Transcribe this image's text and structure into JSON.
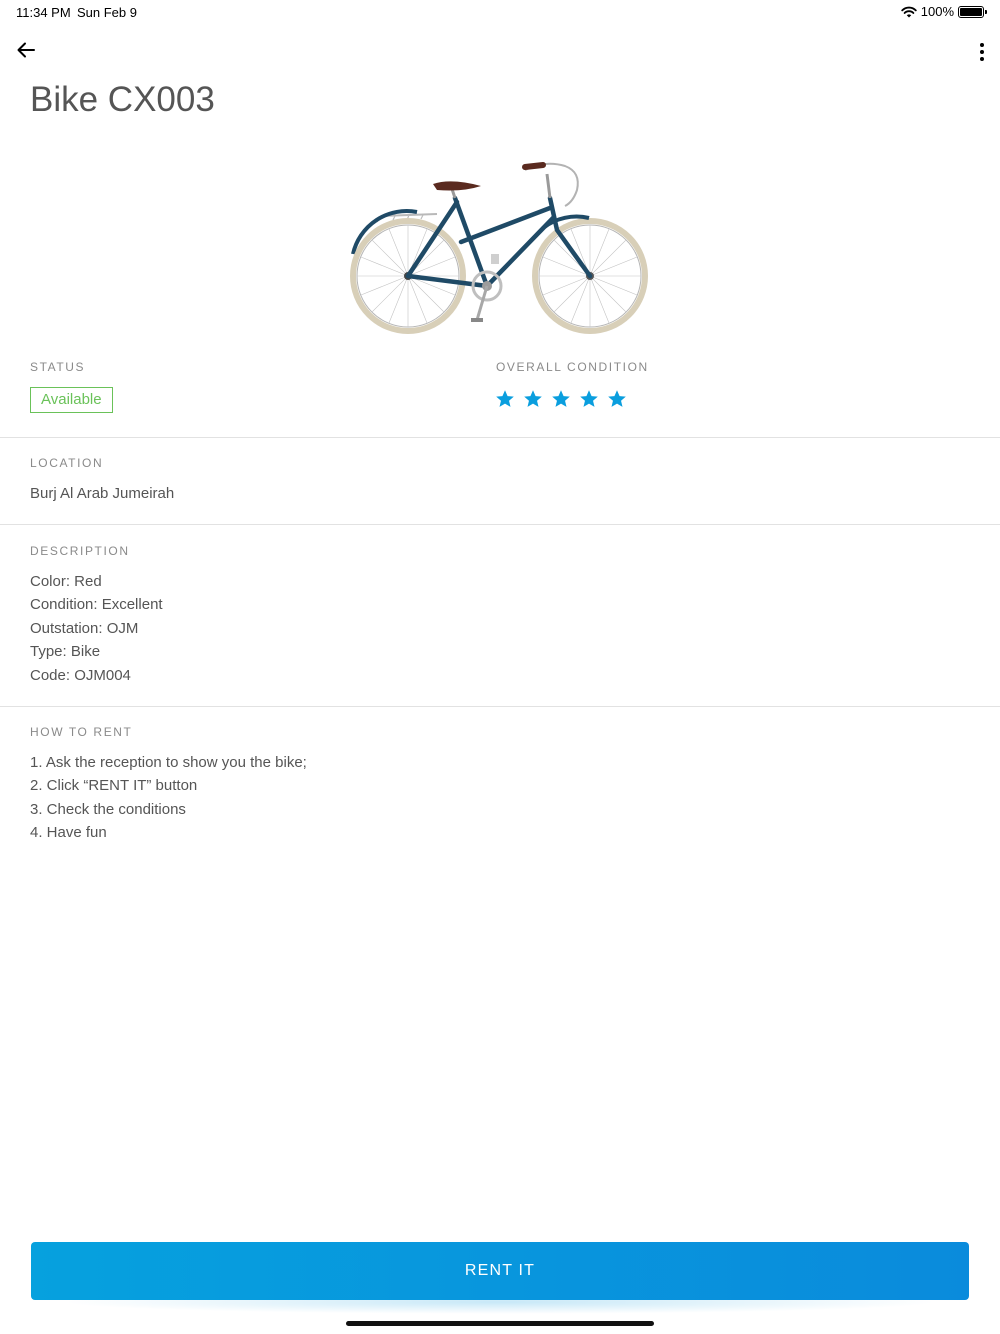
{
  "status_bar": {
    "time": "11:34 PM",
    "date": "Sun Feb 9",
    "battery": "100%"
  },
  "nav": {
    "back_icon": "arrow-left-icon",
    "more_icon": "more-vertical-icon"
  },
  "title": "Bike CX003",
  "bike_image": {
    "icon": "bicycle-illustration",
    "frame_color": "#1f4a66"
  },
  "status": {
    "label": "STATUS",
    "value": "Available",
    "color": "#6ac259"
  },
  "condition": {
    "label": "OVERALL CONDITION",
    "rating": 5,
    "max": 5,
    "star_color": "#0a9ede"
  },
  "location": {
    "label": "LOCATION",
    "value": "Burj Al Arab Jumeirah"
  },
  "description": {
    "label": "DESCRIPTION",
    "lines": [
      "Color: Red",
      "Condition: Excellent",
      "Outstation: OJM",
      "Type: Bike",
      "Code: OJM004"
    ]
  },
  "how_to_rent": {
    "label": "HOW TO RENT",
    "steps": [
      "1. Ask the reception to show you the bike;",
      "2. Click “RENT IT” button",
      "3. Check the conditions",
      "4. Have fun"
    ]
  },
  "rent_button": {
    "label": "RENT IT",
    "color": "#0a9ede"
  }
}
